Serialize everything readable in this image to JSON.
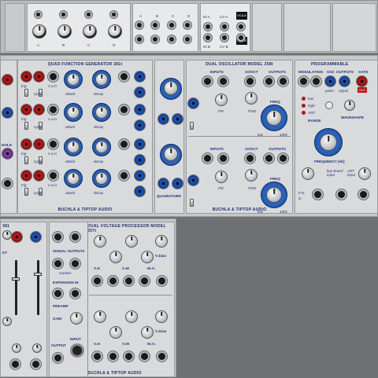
{
  "top_row": {
    "knob_labels": [
      "A",
      "B",
      "C",
      "D"
    ],
    "jack_labels": [
      "A",
      "B",
      "C",
      "D"
    ],
    "io_labels": [
      "IN A",
      "IN B",
      "CV A",
      "CV B"
    ],
    "vca_labels": [
      "VCA A",
      "VCA B"
    ]
  },
  "quad_function": {
    "title": "QUAD FUNCTION GENERATOR 281t",
    "footer": "BUCHLA & TIPTOP AUDIO",
    "row_labels": [
      "trig",
      "cycle",
      "attack",
      "decay",
      "s.o.in"
    ],
    "side_labels": [
      "HOLD"
    ]
  },
  "middle_block": {
    "label": "QUADRATURE"
  },
  "dual_oscillator": {
    "title": "DUAL OSCILLATOR MODEL 258t",
    "footer": "BUCHLA & TIPTOP AUDIO",
    "labels": [
      "INPUTS",
      "1V/OCT",
      "OUTPUTS",
      "FM",
      "FINE",
      "FREQ",
      "low",
      "10hz"
    ]
  },
  "programmable": {
    "title": "PROGRAMMABLE",
    "labels": [
      "MODULATION",
      "OSC",
      "OUTPUTS",
      "GATE",
      "OUT",
      "low",
      "high",
      "ART",
      "RANGE",
      "WAVESHAPE",
      "FREQUENCY (Hz)",
      "key-board input",
      "ART input",
      "F.m.",
      "in",
      "pulse",
      "signal"
    ]
  },
  "lower_left": {
    "title": "381",
    "labels": [
      "KT"
    ]
  },
  "dual_vp": {
    "title": "DUAL VOLTAGE PROCESSOR MODEL 257t",
    "footer": "BUCHLA & TIPTOP AUDIO",
    "labels": [
      "SIGNAL OUTPUTS",
      "monitor",
      "EXPANSION IN",
      "PREAMP",
      "GAIN",
      "INPUT",
      "OUTPUT",
      "V₁K",
      "V₁M",
      "M₁V₁",
      "V₂K",
      "V₂M",
      "M₂V₂",
      "V₁bias",
      "V₂bias"
    ]
  },
  "colors": {
    "panel": "#d9dadc",
    "text_blue": "#1c2a6e",
    "jack_red": "#c21818",
    "jack_blue": "#1d55b8",
    "dial_blue": "#2a64c0",
    "rack": "#6e7072"
  }
}
